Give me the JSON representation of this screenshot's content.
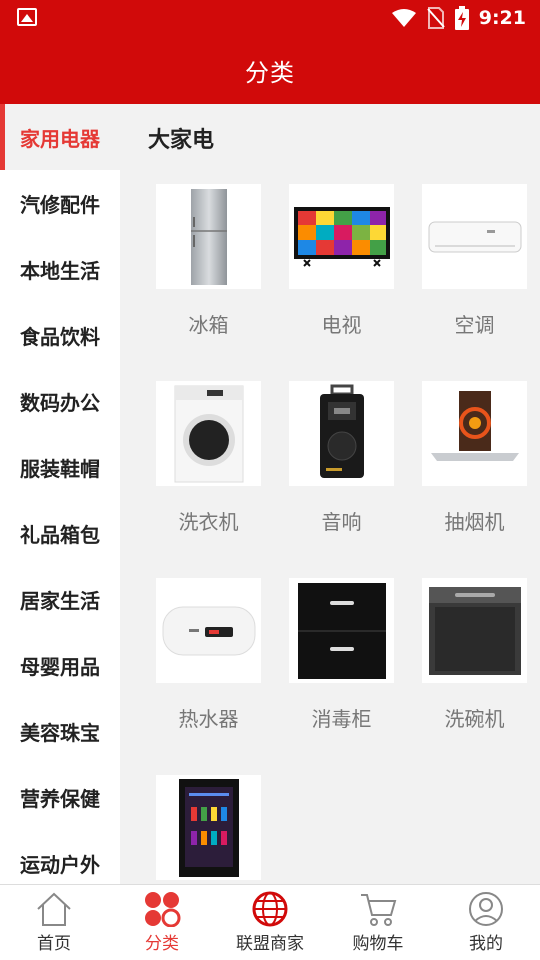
{
  "status_bar": {
    "time": "9:21"
  },
  "header": {
    "title": "分类"
  },
  "sidebar": {
    "items": [
      {
        "label": "家用电器",
        "active": true
      },
      {
        "label": "汽修配件"
      },
      {
        "label": "本地生活"
      },
      {
        "label": "食品饮料"
      },
      {
        "label": "数码办公"
      },
      {
        "label": "服装鞋帽"
      },
      {
        "label": "礼品箱包"
      },
      {
        "label": "居家生活"
      },
      {
        "label": "母婴用品"
      },
      {
        "label": "美容珠宝"
      },
      {
        "label": "营养保健"
      },
      {
        "label": "运动户外"
      }
    ]
  },
  "main": {
    "section_title": "大家电",
    "products": [
      {
        "label": "冰箱",
        "icon": "fridge-icon"
      },
      {
        "label": "电视",
        "icon": "tv-icon"
      },
      {
        "label": "空调",
        "icon": "air-conditioner-icon"
      },
      {
        "label": "洗衣机",
        "icon": "washing-machine-icon"
      },
      {
        "label": "音响",
        "icon": "speaker-icon"
      },
      {
        "label": "抽烟机",
        "icon": "range-hood-icon"
      },
      {
        "label": "热水器",
        "icon": "water-heater-icon"
      },
      {
        "label": "消毒柜",
        "icon": "sterilizer-cabinet-icon"
      },
      {
        "label": "洗碗机",
        "icon": "dishwasher-icon"
      },
      {
        "label": "",
        "icon": "wine-cooler-icon"
      }
    ]
  },
  "bottom_nav": {
    "items": [
      {
        "label": "首页",
        "icon": "home-icon"
      },
      {
        "label": "分类",
        "icon": "category-icon",
        "active": true
      },
      {
        "label": "联盟商家",
        "icon": "globe-icon"
      },
      {
        "label": "购物车",
        "icon": "cart-icon"
      },
      {
        "label": "我的",
        "icon": "user-icon"
      }
    ]
  },
  "colors": {
    "brand_red": "#d10a0a",
    "active_red": "#e53935"
  }
}
